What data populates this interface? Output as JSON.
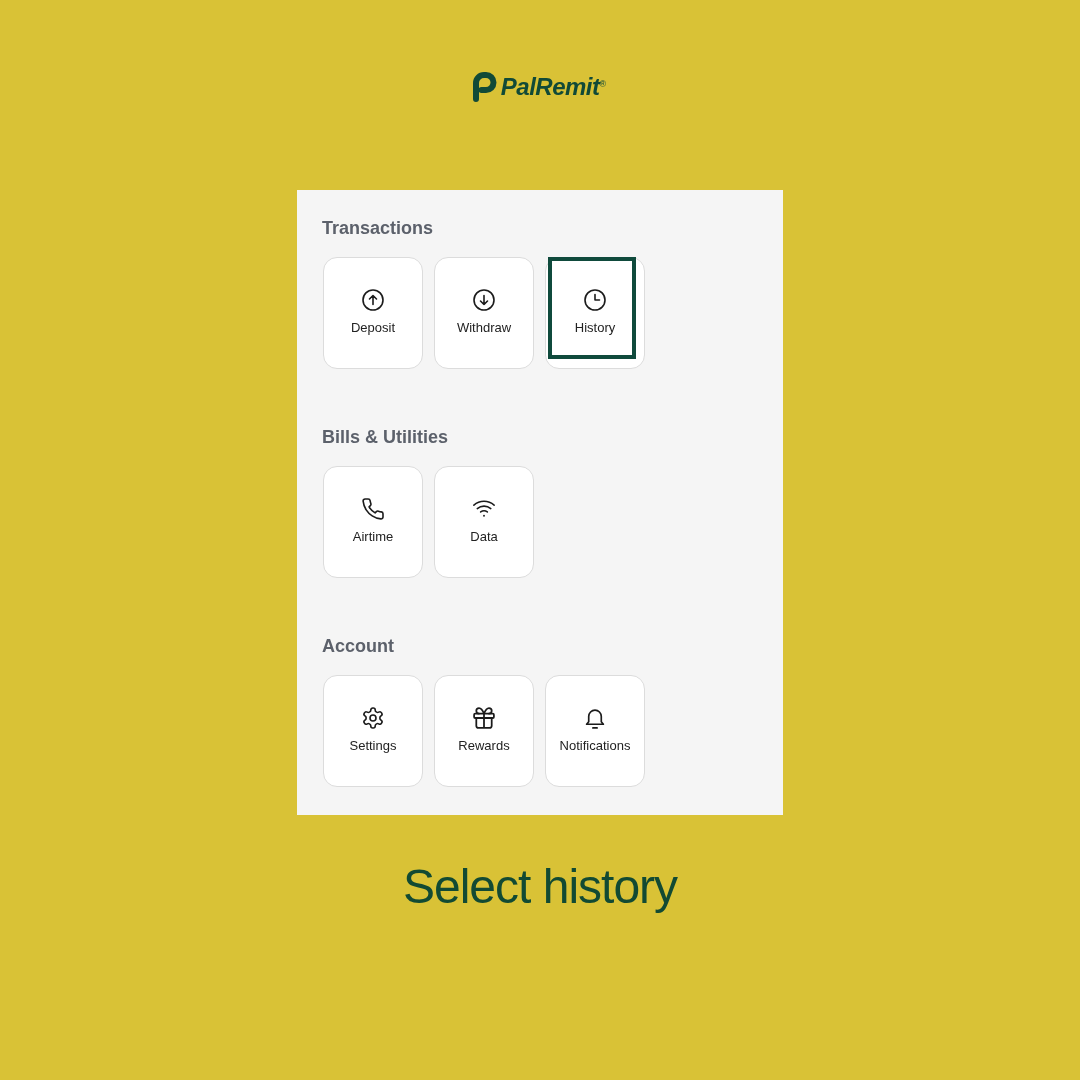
{
  "logo": {
    "name": "PalRemit",
    "mark": "®"
  },
  "sections": [
    {
      "title": "Transactions",
      "tiles": [
        {
          "label": "Deposit",
          "selected": false
        },
        {
          "label": "Withdraw",
          "selected": false
        },
        {
          "label": "History",
          "selected": true
        }
      ]
    },
    {
      "title": "Bills & Utilities",
      "tiles": [
        {
          "label": "Airtime",
          "selected": false
        },
        {
          "label": "Data",
          "selected": false
        }
      ]
    },
    {
      "title": "Account",
      "tiles": [
        {
          "label": "Settings",
          "selected": false
        },
        {
          "label": "Rewards",
          "selected": false
        },
        {
          "label": "Notifications",
          "selected": false
        }
      ]
    }
  ],
  "caption": "Select history"
}
